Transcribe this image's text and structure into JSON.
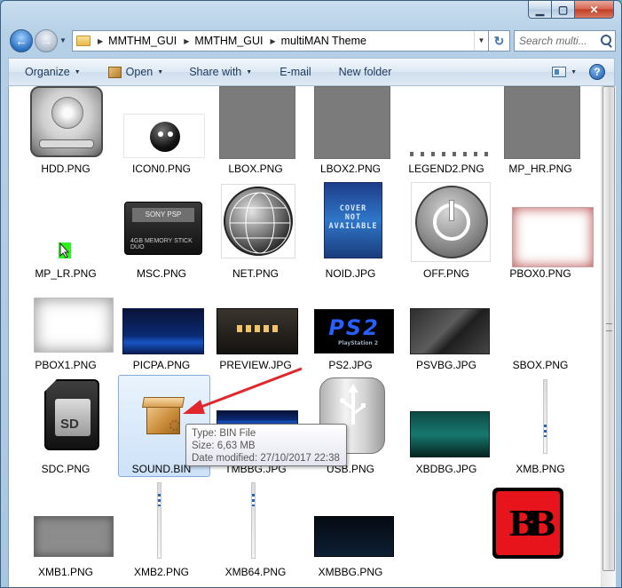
{
  "window": {
    "controls": {
      "minimize": "▁",
      "maximize": "▢",
      "close": "✕"
    }
  },
  "nav": {
    "breadcrumbs": [
      "MMTHM_GUI",
      "MMTHM_GUI",
      "multiMAN Theme"
    ],
    "search_placeholder": "Search multi..."
  },
  "toolbar": {
    "organize": "Organize",
    "open": "Open",
    "share_with": "Share with",
    "email": "E-mail",
    "new_folder": "New folder",
    "help": "?"
  },
  "files": [
    {
      "name": "HDD.PNG",
      "icon": "hard-drive-icon"
    },
    {
      "name": "ICON0.PNG",
      "icon": "black-orb-icon"
    },
    {
      "name": "LBOX.PNG",
      "icon": "gray-box-icon"
    },
    {
      "name": "LBOX2.PNG",
      "icon": "gray-box-icon"
    },
    {
      "name": "LEGEND2.PNG",
      "icon": "legend-strip-icon"
    },
    {
      "name": "MP_HR.PNG",
      "icon": "cursor-green-icon"
    },
    {
      "name": "MP_LR.PNG",
      "icon": "cursor-green-small-icon"
    },
    {
      "name": "MSC.PNG",
      "icon": "memory-stick-icon"
    },
    {
      "name": "NET.PNG",
      "icon": "globe-icon"
    },
    {
      "name": "NOID.JPG",
      "icon": "cover-not-available-icon"
    },
    {
      "name": "OFF.PNG",
      "icon": "power-button-icon"
    },
    {
      "name": "PBOX0.PNG",
      "icon": "red-glow-frame-icon"
    },
    {
      "name": "PBOX1.PNG",
      "icon": "white-glow-frame-icon"
    },
    {
      "name": "PICPA.PNG",
      "icon": "blue-wave-icon"
    },
    {
      "name": "PREVIEW.JPG",
      "icon": "xmb-preview-icon"
    },
    {
      "name": "PS2.JPG",
      "icon": "ps2-logo-icon"
    },
    {
      "name": "PSVBG.JPG",
      "icon": "dark-texture-icon"
    },
    {
      "name": "SBOX.PNG",
      "icon": "gray-box-icon"
    },
    {
      "name": "SDC.PNG",
      "icon": "sd-card-icon"
    },
    {
      "name": "SOUND.BIN",
      "icon": "package-box-icon"
    },
    {
      "name": "TMBBG.JPG",
      "icon": "blue-wave-icon"
    },
    {
      "name": "USB.PNG",
      "icon": "usb-drive-icon"
    },
    {
      "name": "XBDBG.JPG",
      "icon": "teal-rain-icon"
    },
    {
      "name": "XMB.PNG",
      "icon": "vertical-strip-icon"
    },
    {
      "name": "XMB1.PNG",
      "icon": "gray-frame-icon"
    },
    {
      "name": "XMB2.PNG",
      "icon": "vertical-strip-icon"
    },
    {
      "name": "XMB64.PNG",
      "icon": "vertical-strip-icon"
    },
    {
      "name": "XMBBG.PNG",
      "icon": "dark-blue-gradient-icon"
    },
    {
      "name": "",
      "icon": "red-bb-logo-icon"
    }
  ],
  "tooltip": {
    "type": "Type: BIN File",
    "size": "Size: 6,63 MB",
    "modified": "Date modified: 27/10/2017 22:38"
  },
  "colors": {
    "selection": "#cde2f8",
    "arrow": "#e0282c",
    "logo_red": "#e8141c"
  }
}
